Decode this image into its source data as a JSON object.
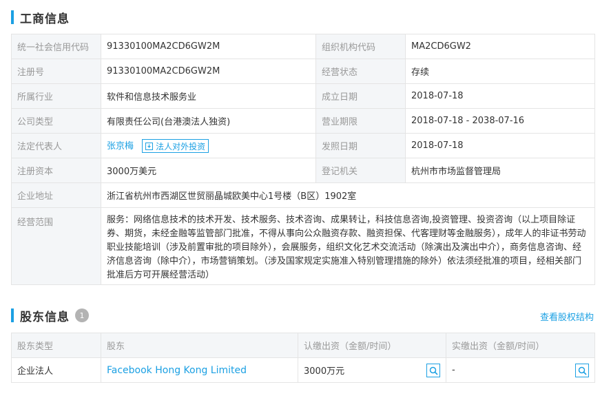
{
  "business_section": {
    "title": "工商信息"
  },
  "info": {
    "credit_code_label": "统一社会信用代码",
    "credit_code": "91330100MA2CD6GW2M",
    "org_code_label": "组织机构代码",
    "org_code": "MA2CD6GW2",
    "reg_no_label": "注册号",
    "reg_no": "91330100MA2CD6GW2M",
    "status_label": "经营状态",
    "status": "存续",
    "industry_label": "所属行业",
    "industry": "软件和信息技术服务业",
    "founded_label": "成立日期",
    "founded": "2018-07-18",
    "company_type_label": "公司类型",
    "company_type": "有限责任公司(台港澳法人独资)",
    "term_label": "营业期限",
    "term": "2018-07-18 - 2038-07-16",
    "legal_rep_label": "法定代表人",
    "legal_rep": "张京梅",
    "invest_button": "法人对外投资",
    "issue_date_label": "发照日期",
    "issue_date": "2018-07-18",
    "capital_label": "注册资本",
    "capital": "3000万美元",
    "authority_label": "登记机关",
    "authority": "杭州市市场监督管理局",
    "address_label": "企业地址",
    "address": "浙江省杭州市西湖区世贸丽晶城欧美中心1号楼（B区）1902室",
    "scope_label": "经营范围",
    "scope": "服务：网络信息技术的技术开发、技术服务、技术咨询、成果转让，科技信息咨询,投资管理、投资咨询（以上项目除证券、期货，未经金融等监管部门批准，不得从事向公众融资存款、融资担保、代客理财等金融服务），成年人的非证书劳动职业技能培训（涉及前置审批的项目除外），会展服务，组织文化艺术交流活动（除演出及演出中介），商务信息咨询、经济信息咨询（除中介），市场营销策划。（涉及国家规定实施准入特别管理措施的除外）依法须经批准的项目，经相关部门批准后方可开展经营活动）"
  },
  "shareholder_section": {
    "title": "股东信息",
    "count": "1",
    "structure_link": "查看股权结构"
  },
  "shareholders": {
    "headers": [
      "股东类型",
      "股东",
      "认缴出资（金额/时间）",
      "实缴出资（金额/时间）"
    ],
    "rows": [
      {
        "type": "企业法人",
        "name": "Facebook Hong Kong Limited",
        "subscribed": "3000万元",
        "paid": "-"
      }
    ]
  },
  "colors": {
    "accent": "#1ba0e3",
    "label_bg": "#f4f6f8",
    "border": "#e4e4e4"
  }
}
